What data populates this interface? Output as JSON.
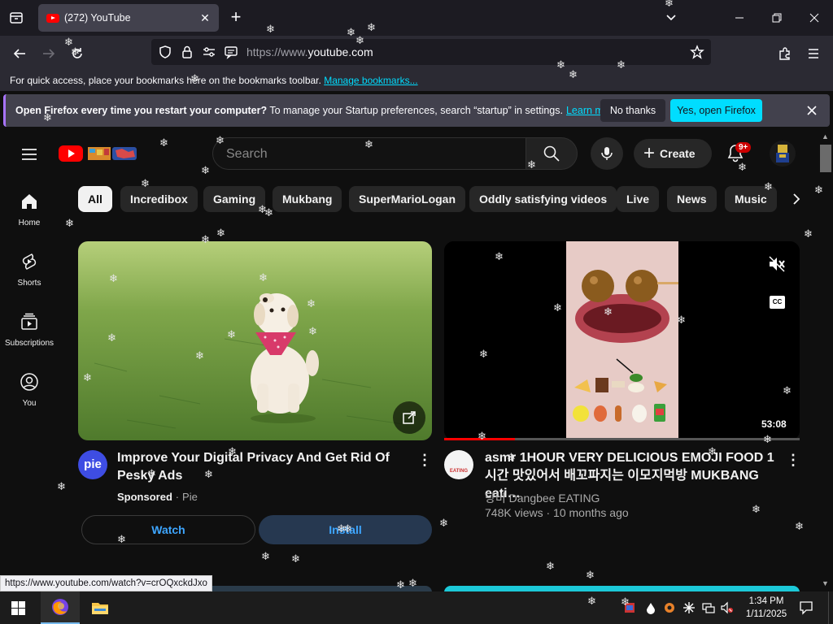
{
  "browser": {
    "tab": {
      "title": "(272) YouTube"
    },
    "url_prefix": "https://www.",
    "url_domain": "youtube.com",
    "bookmarks_bar": {
      "text": "For quick access, place your bookmarks here on the bookmarks toolbar.",
      "link": "Manage bookmarks..."
    },
    "notification": {
      "bold": "Open Firefox every time you restart your computer?",
      "text": " To manage your Startup preferences, search “startup” in settings.",
      "link": "Learn more",
      "no_label": "No thanks",
      "yes_label": "Yes, open Firefox"
    },
    "status_url": "https://www.youtube.com/watch?v=crOQxckdJxo"
  },
  "youtube": {
    "search_placeholder": "Search",
    "create_label": "Create",
    "notifications_badge": "9+",
    "sidebar": [
      {
        "label": "Home",
        "icon": "home-icon"
      },
      {
        "label": "Shorts",
        "icon": "shorts-icon"
      },
      {
        "label": "Subscriptions",
        "icon": "subscriptions-icon"
      },
      {
        "label": "You",
        "icon": "you-icon"
      }
    ],
    "chips": [
      "All",
      "Incredibox",
      "Gaming",
      "Mukbang",
      "SuperMarioLogan",
      "Oddly satisfying videos",
      "Live",
      "News",
      "Music"
    ],
    "ad": {
      "title": "Improve Your Digital Privacy And Get Rid Of Pesky Ads",
      "sponsored": "Sponsored",
      "advertiser": "Pie",
      "channel_avatar_text": "pie",
      "watch_label": "Watch",
      "install_label": "Install"
    },
    "video": {
      "title": "asmr 1HOUR VERY DELICIOUS EMOJI FOOD 1시간 맛있어서 배꼬파지는 이모지먹방 MUKBANG eati…",
      "channel": "당비 Dangbee EATING",
      "views": "748K views",
      "age": "10 months ago",
      "duration": "53:08",
      "progress_fraction": 0.2,
      "cc_label": "CC",
      "channel_avatar_text": "EATING"
    }
  },
  "taskbar": {
    "time": "1:34 PM",
    "date": "1/11/2025"
  },
  "colors": {
    "firefox_tabbar": "#1c1b22",
    "firefox_toolbar": "#2b2a33",
    "firefox_accent": "#00ddff",
    "youtube_bg": "#0f0f0f",
    "youtube_red": "#ff0000",
    "link_blue": "#3ea6ff"
  }
}
